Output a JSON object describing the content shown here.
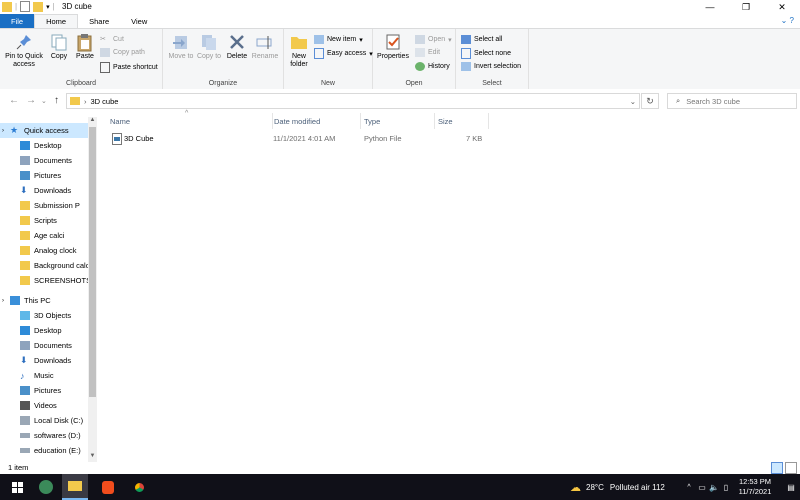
{
  "window": {
    "title": "3D cube"
  },
  "tabs": [
    {
      "label": "File"
    },
    {
      "label": "Home"
    },
    {
      "label": "Share"
    },
    {
      "label": "View"
    }
  ],
  "ribbon": {
    "clipboard": {
      "label": "Clipboard",
      "pin": "Pin to Quick access",
      "copy": "Copy",
      "paste": "Paste",
      "cut": "Cut",
      "copy_path": "Copy path",
      "paste_shortcut": "Paste shortcut"
    },
    "organize": {
      "label": "Organize",
      "move_to": "Move to",
      "copy_to": "Copy to",
      "delete": "Delete",
      "rename": "Rename"
    },
    "new": {
      "label": "New",
      "new_folder": "New folder",
      "new_item": "New item",
      "easy_access": "Easy access"
    },
    "open": {
      "label": "Open",
      "properties": "Properties",
      "open": "Open",
      "edit": "Edit",
      "history": "History"
    },
    "select": {
      "label": "Select",
      "select_all": "Select all",
      "select_none": "Select none",
      "invert": "Invert selection"
    }
  },
  "address": {
    "path": "3D cube",
    "search_placeholder": "Search 3D cube"
  },
  "nav": {
    "quick_access": "Quick access",
    "quick_items": [
      "Desktop",
      "Documents",
      "Pictures",
      "Downloads",
      "Submission P",
      "Scripts",
      "Age calci",
      "Analog clock",
      "Background calc",
      "SCREENSHOTS"
    ],
    "this_pc": "This PC",
    "pc_items": [
      "3D Objects",
      "Desktop",
      "Documents",
      "Downloads",
      "Music",
      "Pictures",
      "Videos",
      "Local Disk (C:)",
      "softwares (D:)",
      "education (E:)"
    ]
  },
  "columns": {
    "name": "Name",
    "date": "Date modified",
    "type": "Type",
    "size": "Size"
  },
  "files": [
    {
      "name": "3D Cube",
      "date": "11/1/2021 4:01 AM",
      "type": "Python File",
      "size": "7 KB"
    }
  ],
  "status": {
    "count": "1 item"
  },
  "taskbar": {
    "weather": "28°C",
    "weather_text": "Polluted air 112",
    "time": "12:53 PM",
    "date": "11/7/2021"
  }
}
